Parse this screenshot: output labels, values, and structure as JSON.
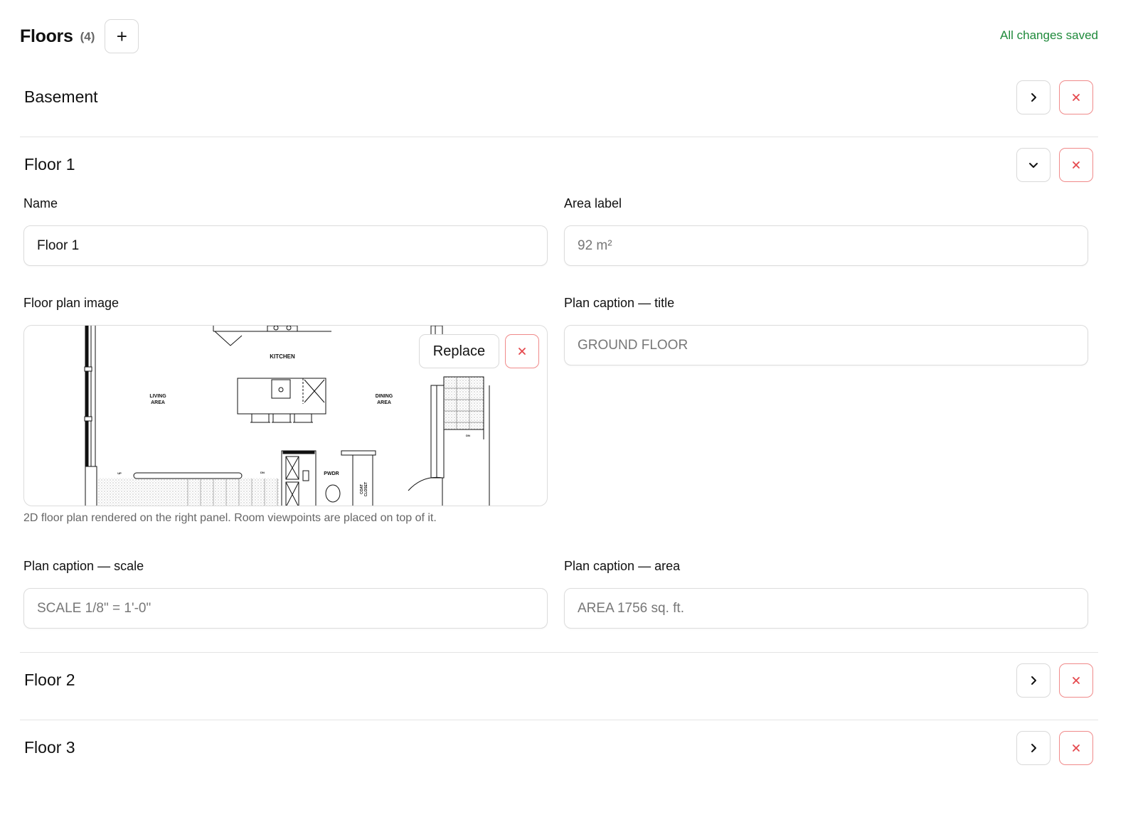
{
  "header": {
    "title": "Floors",
    "count": "(4)",
    "add_label": "+",
    "status": "All changes saved"
  },
  "floors": [
    {
      "name": "Basement",
      "expanded": false
    },
    {
      "name": "Floor 1",
      "expanded": true
    },
    {
      "name": "Floor 2",
      "expanded": false
    },
    {
      "name": "Floor 3",
      "expanded": false
    }
  ],
  "editor": {
    "name_label": "Name",
    "name_value": "Floor 1",
    "area_label": "Area label",
    "area_placeholder": "92 m²",
    "image_label": "Floor plan image",
    "replace_label": "Replace",
    "image_hint": "2D floor plan rendered on the right panel. Room viewpoints are placed on top of it.",
    "caption_title_label": "Plan caption — title",
    "caption_title_placeholder": "GROUND FLOOR",
    "caption_scale_label": "Plan caption — scale",
    "caption_scale_placeholder": "SCALE 1/8\" = 1'-0\"",
    "caption_area_label": "Plan caption — area",
    "caption_area_placeholder": "AREA 1756 sq. ft."
  },
  "plan_labels": {
    "kitchen": "KITCHEN",
    "living_1": "LIVING",
    "living_2": "AREA",
    "dining_1": "DINING",
    "dining_2": "AREA",
    "pwdr": "PWDR",
    "coat_1": "COAT",
    "coat_2": "CLOSET",
    "up": "UP",
    "dn": "DN"
  },
  "colors": {
    "accent_green": "#1f8a3b",
    "danger_red": "#e5484d",
    "border": "#d9d9d9"
  },
  "icons": {
    "add": "plus-icon",
    "collapsed": "chevron-right-icon",
    "expanded": "chevron-down-icon",
    "delete": "close-icon"
  }
}
